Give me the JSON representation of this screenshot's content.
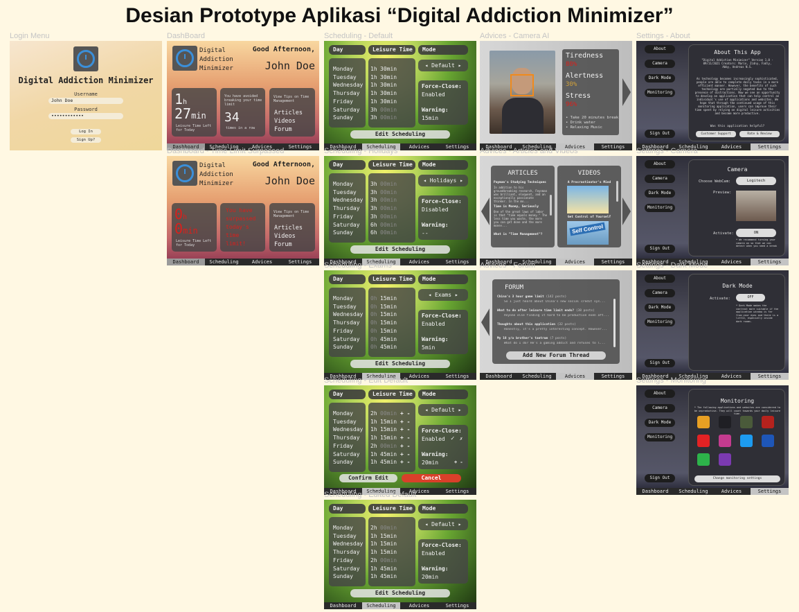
{
  "page_title": "Desian Prototype Aplikasi “Digital Addiction Minimizer”",
  "frame_labels": {
    "login": "Login Menu",
    "dashboard": "DashBoard",
    "dashboard_surpassed": "Dashboard - Time Limit Surpassed",
    "sched_default": "Scheduling - Default",
    "sched_holidays": "Scheduling - Holidays",
    "sched_exams": "Scheduling - Exams",
    "sched_edit": "Scheduling - Edit Default",
    "sched_edited": "Scheduling - Edited Default",
    "adv_camera": "Advices - Camera AI",
    "adv_articles": "Advices - Articles and Videos",
    "adv_forum": "Advices - Forum",
    "set_about": "Settings - About",
    "set_camera": "Settings - Camera",
    "set_dark": "Settings - Dark Mode",
    "set_monitoring": "Settings - Monitoring"
  },
  "nav": [
    "Dashboard",
    "Scheduling",
    "Advices",
    "Settings"
  ],
  "login": {
    "app_name": "Digital Addiction Minimizer",
    "username_label": "Username",
    "username_value": "John Doe",
    "password_label": "Password",
    "password_value": "••••••••••••",
    "login_button": "Log In",
    "signup_button": "Sign Up?"
  },
  "dashboard": {
    "app_name_1": "Digital",
    "app_name_2": "Addiction",
    "app_name_3": "Minimizer",
    "greeting": "Good Afternoon,",
    "user": "John Doe",
    "hours": "1",
    "h": "h",
    "minutes": "27",
    "min": "min",
    "time_left_1": "Leisure Time Left",
    "time_left_2": "for Today",
    "avoided_text": "You have avoided breaking your time limit",
    "streak": "34",
    "streak_text": "times in a row",
    "tips_text": "View Tips on Time Management",
    "links": [
      "Articles",
      "Videos",
      "Forum"
    ]
  },
  "surpassed": {
    "hours": "0",
    "minutes": "0",
    "warning": [
      "You have",
      "surpassed",
      "today's",
      "time",
      "limit!"
    ]
  },
  "schedule_headers": {
    "day": "Day",
    "leisure": "Leisure Time",
    "mode": "Mode"
  },
  "days": [
    "Monday",
    "Tuesday",
    "Wednesday",
    "Thursday",
    "Friday",
    "Saturday",
    "Sunday"
  ],
  "sched_default": {
    "hours": [
      "1h",
      "1h",
      "1h",
      "1h",
      "1h",
      "3h",
      "3h"
    ],
    "mins": [
      "30min",
      "30min",
      "30min",
      "30min",
      "30min",
      "00min",
      "00min"
    ],
    "mode": "◂ Default ▸",
    "force_label": "Force-Close:",
    "force_value": "Enabled",
    "warning_label": "Warning:",
    "warning_value": "15min",
    "button": "Edit Scheduling"
  },
  "sched_holidays": {
    "hours": [
      "3h",
      "3h",
      "3h",
      "3h",
      "3h",
      "6h",
      "6h"
    ],
    "mins": [
      "00min",
      "00min",
      "00min",
      "00min",
      "00min",
      "00min",
      "00min"
    ],
    "mode": "◂ Holidays ▸",
    "force_value": "Disabled",
    "warning_value": "--"
  },
  "sched_exams": {
    "hours": [
      "0h",
      "0h",
      "0h",
      "0h",
      "0h",
      "0h",
      "0h"
    ],
    "mins": [
      "15min",
      "15min",
      "15min",
      "15min",
      "15min",
      "45min",
      "45min"
    ],
    "mode": "◂ Exams ▸",
    "force_value": "Enabled",
    "warning_value": "5min"
  },
  "sched_edit": {
    "hours": [
      "2h",
      "1h",
      "1h",
      "1h",
      "2h",
      "1h",
      "1h"
    ],
    "mins": [
      "00min",
      "15min",
      "15min",
      "15min",
      "00min",
      "45min",
      "45min"
    ],
    "mode": "◂ Default ▸",
    "force_value": "Enabled",
    "check": "✓",
    "cross": "✗",
    "warning_value": "20min",
    "plusminus": "+ -",
    "confirm": "Confirm Edit",
    "cancel": "Cancel"
  },
  "advices_camera": {
    "tiredness": "Tiredness",
    "tiredness_val": "80%",
    "alertness": "Alertness",
    "alertness_val": "30%",
    "stress": "Stress",
    "stress_val": "96%",
    "tips": [
      "• Take 20 minutes break",
      "• Drink water",
      "• Relaxing Music"
    ]
  },
  "advices_articles": {
    "articles_title": "ARTICLES",
    "videos_title": "VIDEOS",
    "article1_title": "Payman's Studying Techniques",
    "article1_body": "In addition to his groundbreaking research, Feynman was brilliant, eloquent, and an exceptionally passionate thinker. In the mo...",
    "article2_title": "Time is Money, Seriously",
    "article2_body": "One of the great laws of labor is that \"time equals money.\" The less time you waste, the more you can get done and the more money...",
    "article3_title": "What is \"Time Management\"?",
    "video1_title": "A Procrastinator's Mind",
    "video2_title": "Get Control of Yourself",
    "video2_sign": "Self Control"
  },
  "advices_forum": {
    "title": "FORUM",
    "threads": [
      {
        "title": "China's 3 hour game limit",
        "posts": "(142 posts)",
        "preview": "So I just heard about China's new social credit sys..."
      },
      {
        "title": "What to do after leisure time limit ends?",
        "posts": "(38 posts)",
        "preview": "Anyone else finding it hard to be productive even aft..."
      },
      {
        "title": "Thoughts about this application",
        "posts": "(32 posts)",
        "preview": "Honestly, it's a pretty interesting concept. However..."
      },
      {
        "title": "My 18 y/o brother's tantrum",
        "posts": "(7 posts)",
        "preview": "What do I do? He's a gaming addict and refuses to l..."
      }
    ],
    "add_button": "Add New Forum Thread"
  },
  "settings": {
    "side": [
      "About",
      "Camera",
      "Dark Mode",
      "Monitoring"
    ],
    "signout": "Sign Out",
    "about_title": "About This App",
    "about_meta": "\"Digital Addiction Minimizer\" Version 1.0 - 09/11/2021 Creators: Mario, Zidny, Fadly, Abby, Andreas N.S.",
    "about_body": "As technology becomes increasingly sophisticated, people are able to complete daily tasks in a more efficient manner. However, the benefits of such technology are partially negated due to the presence of distractions. Now we see an opportunity to develop an application that can help control an individual's use of applications and websites. We hope that through the continued usage of this monitoring application, users can improve their time spent by relying on digital leisure activities and become more productive.",
    "helpful": "Was this application helpful?",
    "support": "Customer Support",
    "rate": "Rate & Review",
    "camera_title": "Camera",
    "webcam_label": "Choose WebCam:",
    "webcam_value": "Logitech",
    "preview_label": "Preview:",
    "activate_label": "Activate:",
    "camera_on": "ON",
    "camera_note": "* We recommend turning your camera on so that we can detect when you need a break",
    "dark_title": "Dark Mode",
    "dark_off": "OFF",
    "dark_note": "* Dark Mode makes the contrast more suitable if the application window is far from your eyes and there is a little, especially inside dark rooms.",
    "monitor_title": "Monitoring",
    "monitor_note": "* The following applications and websites are considered to be unproductive. They will count towards your daily leisure time.",
    "change_button": "Change monitoring settings"
  },
  "colors": {
    "red": "#d9201c",
    "accent": "#3b8fd9",
    "alert_green": "#7ec850"
  }
}
